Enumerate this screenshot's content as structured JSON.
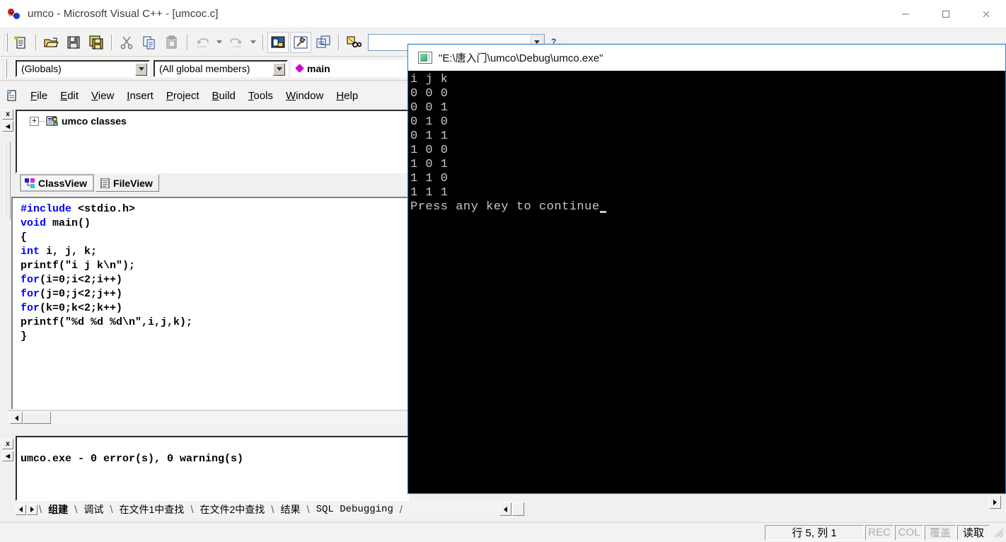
{
  "window": {
    "title": "umco - Microsoft Visual C++ - [umcoc.c]",
    "app_icon": "vcpp-icon",
    "minimize_label": "Minimize",
    "maximize_label": "Maximize",
    "close_label": "Close"
  },
  "toolbar": {
    "buttons": [
      {
        "name": "new-text-file-icon",
        "label": "New"
      },
      {
        "name": "open-folder-icon",
        "label": "Open"
      },
      {
        "name": "save-icon",
        "label": "Save"
      },
      {
        "name": "save-all-icon",
        "label": "Save All"
      },
      {
        "name": "cut-scissors-icon",
        "label": "Cut"
      },
      {
        "name": "copy-icon",
        "label": "Copy"
      },
      {
        "name": "paste-icon",
        "label": "Paste"
      },
      {
        "name": "undo-icon",
        "label": "Undo"
      },
      {
        "name": "redo-icon",
        "label": "Redo"
      },
      {
        "name": "workspace-icon",
        "label": "Workspace"
      },
      {
        "name": "build-hammer-icon",
        "label": "Build"
      },
      {
        "name": "output-window-icon",
        "label": "Output Window"
      },
      {
        "name": "find-in-files-icon",
        "label": "Find in Files"
      }
    ],
    "find_value": "",
    "find_placeholder": "",
    "help_label": "?"
  },
  "combobar": {
    "globals": "(Globals)",
    "members": "(All global members)",
    "symbol": "main"
  },
  "menubar": {
    "items": [
      {
        "pre": "",
        "mnemonic": "F",
        "post": "ile"
      },
      {
        "pre": "",
        "mnemonic": "E",
        "post": "dit"
      },
      {
        "pre": "",
        "mnemonic": "V",
        "post": "iew"
      },
      {
        "pre": "",
        "mnemonic": "I",
        "post": "nsert"
      },
      {
        "pre": "",
        "mnemonic": "P",
        "post": "roject"
      },
      {
        "pre": "",
        "mnemonic": "B",
        "post": "uild"
      },
      {
        "pre": "",
        "mnemonic": "T",
        "post": "ools"
      },
      {
        "pre": "",
        "mnemonic": "W",
        "post": "indow"
      },
      {
        "pre": "",
        "mnemonic": "H",
        "post": "elp"
      }
    ]
  },
  "workspace": {
    "close_label": "x",
    "collapse_label": "◀",
    "tree_root": "umco classes",
    "expander": "+",
    "tabs": [
      {
        "label": "ClassView",
        "icon": "class-view-icon",
        "active": true
      },
      {
        "label": "FileView",
        "icon": "file-view-icon",
        "active": false
      }
    ]
  },
  "editor": {
    "lines": [
      [
        {
          "t": "#include",
          "c": "kw"
        },
        {
          "t": " <stdio.h>",
          "c": ""
        }
      ],
      [
        {
          "t": "void",
          "c": "kw"
        },
        {
          "t": " main()",
          "c": ""
        }
      ],
      [
        {
          "t": "{",
          "c": ""
        }
      ],
      [
        {
          "t": "int",
          "c": "kw"
        },
        {
          "t": " i, j, k;",
          "c": ""
        }
      ],
      [
        {
          "t": "printf(\"i j k\\n\");",
          "c": ""
        }
      ],
      [
        {
          "t": "for",
          "c": "kw"
        },
        {
          "t": "(i=0;i<2;i++)",
          "c": ""
        }
      ],
      [
        {
          "t": "for",
          "c": "kw"
        },
        {
          "t": "(j=0;j<2;j++)",
          "c": ""
        }
      ],
      [
        {
          "t": "for",
          "c": "kw"
        },
        {
          "t": "(k=0;k<2;k++)",
          "c": ""
        }
      ],
      [
        {
          "t": "printf(\"%d %d %d\\n\",i,j,k);",
          "c": ""
        }
      ],
      [
        {
          "t": "}",
          "c": ""
        }
      ]
    ]
  },
  "output": {
    "close_label": "x",
    "collapse_label": "◀",
    "text": "umco.exe - 0 error(s), 0 warning(s)",
    "tabs": [
      {
        "label": "组建",
        "active": true,
        "mono": false
      },
      {
        "label": "调试",
        "active": false,
        "mono": false
      },
      {
        "label": "在文件1中查找",
        "active": false,
        "mono": false
      },
      {
        "label": "在文件2中查找",
        "active": false,
        "mono": false
      },
      {
        "label": "结果",
        "active": false,
        "mono": false
      },
      {
        "label": "SQL Debugging",
        "active": false,
        "mono": true
      }
    ]
  },
  "statusbar": {
    "position": "行 5, 列 1",
    "rec": "REC",
    "col": "COL",
    "ovr": "覆盖",
    "read": "读取"
  },
  "console": {
    "title": "\"E:\\唐入门\\umco\\Debug\\umco.exe\"",
    "icon": "console-window-icon",
    "lines": [
      "i j k",
      "0 0 0",
      "0 0 1",
      "0 1 0",
      "0 1 1",
      "1 0 0",
      "1 0 1",
      "1 1 0",
      "1 1 1"
    ],
    "prompt": "Press any key to continue"
  },
  "colors": {
    "keyword_blue": "#0000ff",
    "console_bg": "#000000",
    "console_fg": "#c8c8c8",
    "active_border": "#2a7fd4",
    "chrome": "#f2f2f2"
  }
}
